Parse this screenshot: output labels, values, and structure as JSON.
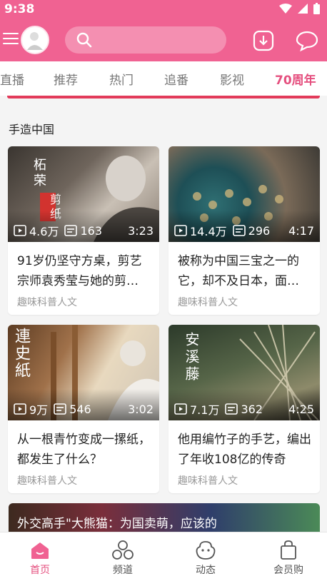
{
  "status": {
    "time": "9:38"
  },
  "header": {
    "search_placeholder": ""
  },
  "tabs": [
    {
      "label": "直播"
    },
    {
      "label": "推荐"
    },
    {
      "label": "热门"
    },
    {
      "label": "追番"
    },
    {
      "label": "影视"
    },
    {
      "label": "70周年"
    }
  ],
  "section": {
    "title": "手造中国"
  },
  "cards": [
    {
      "views": "4.6万",
      "danmaku": "163",
      "duration": "3:23",
      "title": "91岁仍坚守方桌，剪艺宗师袁秀莹与她的剪…",
      "channel": "趣味科普人文",
      "thumb_text": "柘荣",
      "thumb_text2": "剪纸"
    },
    {
      "views": "14.4万",
      "danmaku": "296",
      "duration": "4:17",
      "title": "被称为中国三宝之一的它，却不及日本，面…",
      "channel": "趣味科普人文"
    },
    {
      "views": "9万",
      "danmaku": "546",
      "duration": "3:02",
      "title": "从一根青竹变成一摞纸，都发生了什么？",
      "channel": "趣味科普人文",
      "thumb_text": "連史紙"
    },
    {
      "views": "7.1万",
      "danmaku": "362",
      "duration": "4:25",
      "title": "他用编竹子的手艺，编出了年收108亿的传奇",
      "channel": "趣味科普人文",
      "thumb_text": "安溪藤"
    }
  ],
  "banner": {
    "title": "外交高手\"大熊猫：为国卖萌，应该的"
  },
  "bottom_nav": [
    {
      "label": "首页"
    },
    {
      "label": "频道"
    },
    {
      "label": "动态"
    },
    {
      "label": "会员购"
    }
  ],
  "colors": {
    "brand": "#f06292",
    "accent": "#e5507f"
  }
}
